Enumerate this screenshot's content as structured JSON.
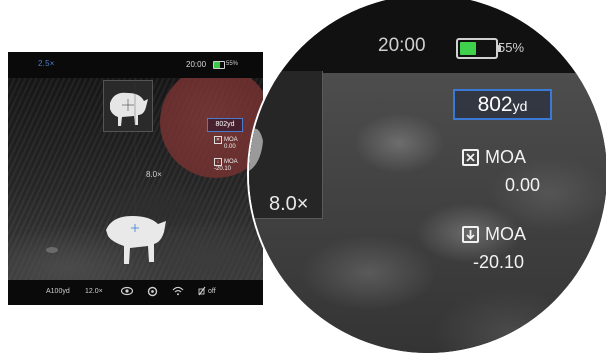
{
  "full_screen": {
    "zoom_top": "2.5×",
    "time": "20:00",
    "battery_pct": "55%",
    "battery_level": 0.55,
    "pip_zoom": "8.0×",
    "distance": "802yd",
    "wind_label": "MOA",
    "wind_value": "0.00",
    "elev_label": "MOA",
    "elev_value": "-20.10",
    "bottom_bar": {
      "range": "A100yd",
      "zoom": "12.0×",
      "eye_icon": "eye-icon",
      "settings_icon": "settings-icon",
      "wifi_icon": "wifi-icon",
      "rec_label": "off"
    },
    "mic_icon": "mic-icon"
  },
  "magnified": {
    "time": "20:00",
    "battery_pct": "55%",
    "battery_level": 0.55,
    "pip_zoom": "8.0×",
    "distance_value": "802",
    "distance_unit": "yd",
    "wind_label": "MOA",
    "wind_value": "0.00",
    "elev_label": "MOA",
    "elev_value": "-20.10"
  },
  "colors": {
    "accent_blue": "#3a7ad6",
    "battery_green": "#3fd04c",
    "magnifier_red": "#8c3c3c"
  }
}
